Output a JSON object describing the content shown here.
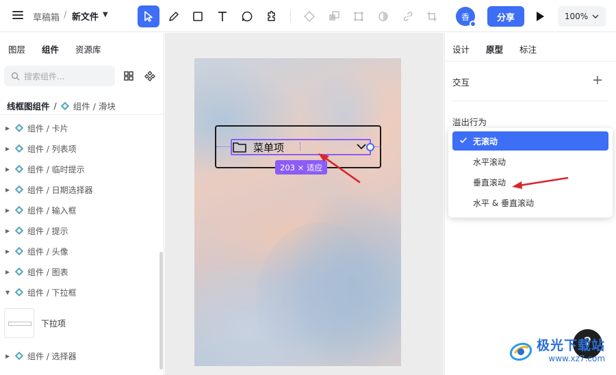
{
  "header": {
    "breadcrumb_folder": "草稿箱",
    "breadcrumb_sep": "/",
    "file_name": "新文件",
    "share_label": "分享",
    "zoom_level": "100%",
    "avatar_char": "香",
    "accent_color": "#3c6ef6",
    "tools": [
      "move-icon",
      "pen-icon",
      "rectangle-icon",
      "text-icon",
      "comment-icon",
      "plugin-icon",
      "component-icon",
      "boolean-icon",
      "frame-icon",
      "mask-icon",
      "link-icon",
      "crop-icon"
    ]
  },
  "left_panel": {
    "tabs": [
      "图层",
      "组件",
      "资源库"
    ],
    "active_tab": "组件",
    "search_placeholder": "搜索组件...",
    "library_name": "线框图组件",
    "library_sep": "/",
    "current_path": "组件 / 滑块",
    "tree_items": [
      "组件 / 卡片",
      "组件 / 列表项",
      "组件 / 临时提示",
      "组件 / 日期选择器",
      "组件 / 输入框",
      "组件 / 提示",
      "组件 / 头像",
      "组件 / 图表",
      "组件 / 下拉框"
    ],
    "expanded_child": "下拉项",
    "last_item": "组件 / 选择器"
  },
  "canvas": {
    "dropdown_text": "菜单项",
    "size_badge": "203 × 适应"
  },
  "right_panel": {
    "tabs": [
      "设计",
      "原型",
      "标注"
    ],
    "active_tab": "原型",
    "interaction_label": "交互",
    "overflow_label": "溢出行为",
    "overflow_options": [
      "无滚动",
      "水平滚动",
      "垂直滚动",
      "水平 & 垂直滚动"
    ],
    "selected_option": "无滚动"
  },
  "help": {
    "label": "?"
  },
  "watermark": {
    "cn": "极光下载站",
    "en": "www.xz7.com"
  }
}
